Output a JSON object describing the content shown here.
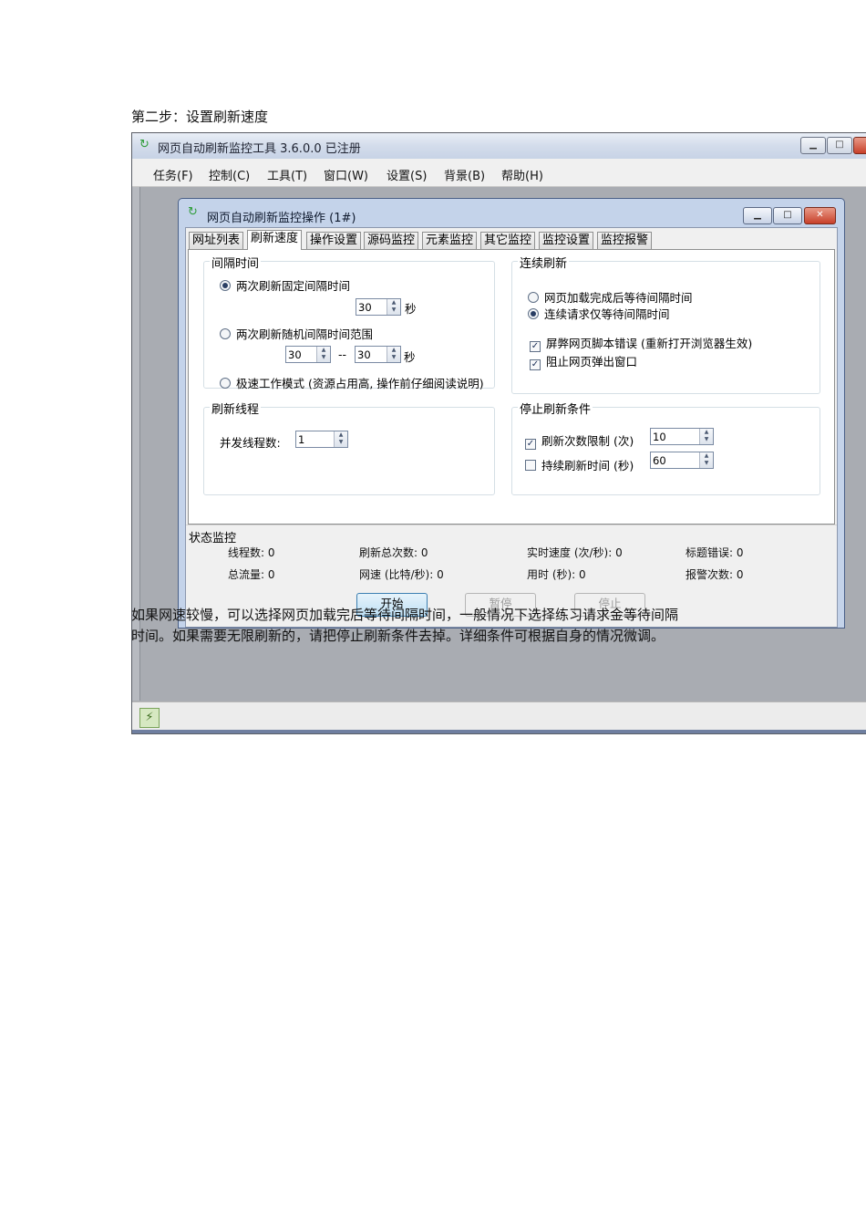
{
  "doc": {
    "step_title": "第二步：设置刷新速度",
    "paragraph_line1": "如果网速较慢，可以选择网页加载完后等待间隔时间，一般情况下选择练习请求金等待间隔",
    "paragraph_line2": "时间。如果需要无限刷新的，请把停止刷新条件去掉。详细条件可根据自身的情况微调。"
  },
  "app": {
    "title": "网页自动刷新监控工具 3.6.0.0 已注册",
    "icon": "refresh-icon",
    "menu": [
      "任务(F)",
      "控制(C)",
      "工具(T)",
      "窗口(W)",
      "设置(S)",
      "背景(B)",
      "帮助(H)"
    ],
    "status_icon": "plug-icon"
  },
  "dialog": {
    "title": "网页自动刷新监控操作 (1#)",
    "tabs": [
      "网址列表",
      "刷新速度",
      "操作设置",
      "源码监控",
      "元素监控",
      "其它监控",
      "监控设置",
      "监控报警"
    ],
    "active_tab": "刷新速度",
    "interval": {
      "label": "间隔时间",
      "fixed_label": "两次刷新固定间隔时间",
      "fixed_value": "30",
      "random_label": "两次刷新随机间隔时间范围",
      "random_from": "30",
      "random_sep": "--",
      "random_to": "30",
      "unit": "秒",
      "fast_label": "极速工作模式 (资源占用高, 操作前仔细阅读说明)",
      "selected": "fixed"
    },
    "continuous": {
      "label": "连续刷新",
      "wait_after_load": "网页加载完成后等待间隔时间",
      "wait_after_request": "连续请求仅等待间隔时间",
      "selected": "wait_after_request",
      "block_script_errors": "屏弊网页脚本错误 (重新打开浏览器生效)",
      "block_popups": "阻止网页弹出窗口"
    },
    "threads": {
      "label": "刷新线程",
      "concurrent_label": "并发线程数:",
      "concurrent_value": "1"
    },
    "stop": {
      "label": "停止刷新条件",
      "count_label": "刷新次数限制 (次)",
      "count_value": "10",
      "count_checked": true,
      "duration_label": "持续刷新时间 (秒)",
      "duration_value": "60",
      "duration_checked": false
    },
    "status": {
      "label": "状态监控",
      "threads": "线程数:  0",
      "total_refresh": "刷新总次数:  0",
      "realtime_speed": "实时速度 (次/秒):  0",
      "title_errors": "标题错误:  0",
      "total_traffic": "总流量:  0",
      "net_speed": "网速 (比特/秒):  0",
      "elapsed": "用时 (秒):  0",
      "alarm_count": "报警次数:  0"
    },
    "buttons": {
      "start": "开始",
      "pause": "暂停",
      "stop": "停止"
    }
  }
}
